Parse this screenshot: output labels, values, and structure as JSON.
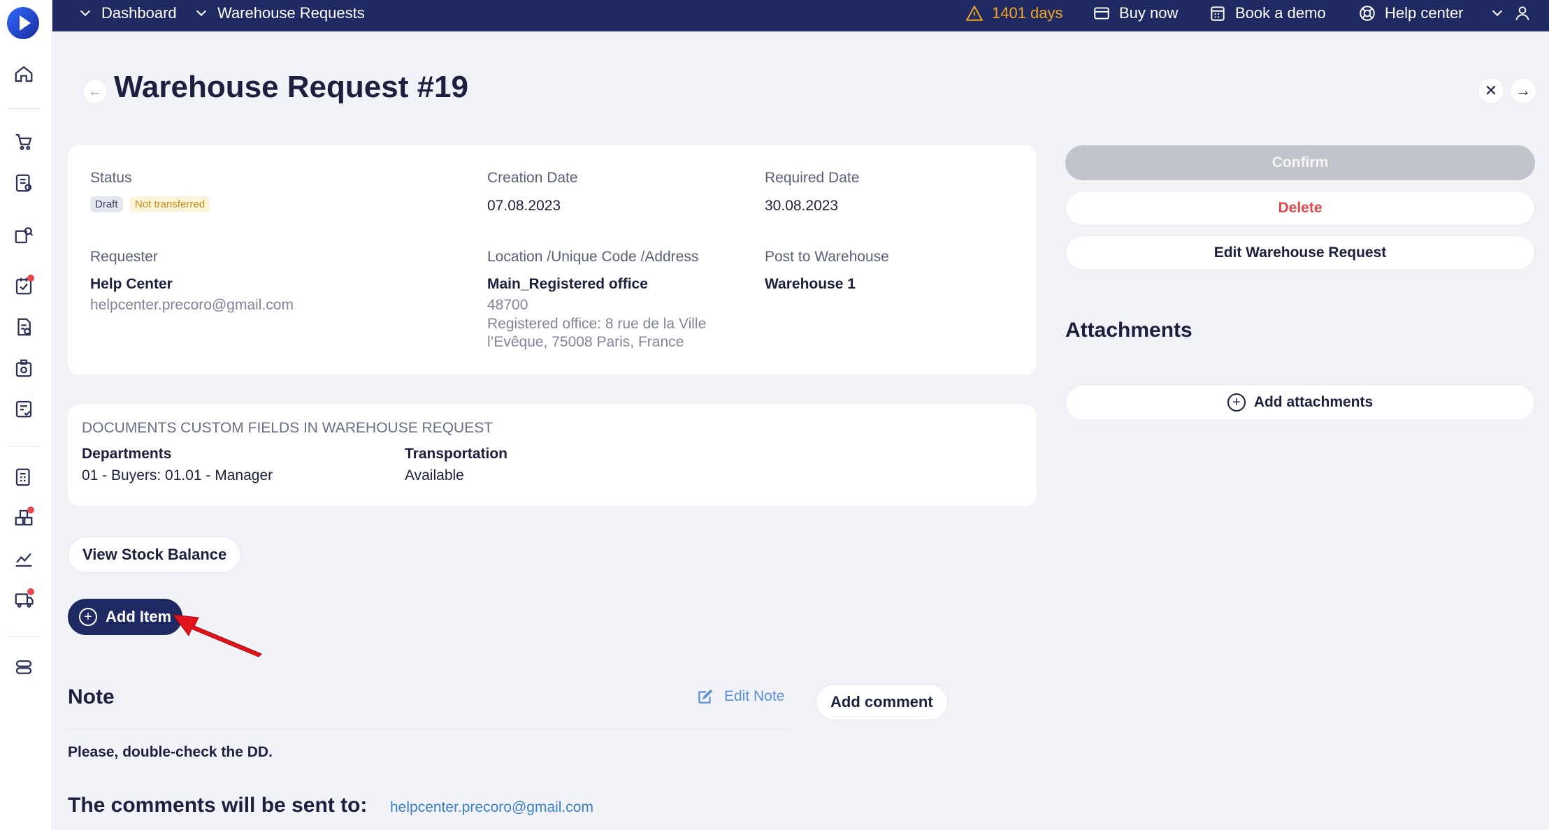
{
  "topbar": {
    "breadcrumb_1": "Dashboard",
    "breadcrumb_2": "Warehouse Requests",
    "trial": "1401 days",
    "buy_now": "Buy now",
    "book_demo": "Book a demo",
    "help_center": "Help center"
  },
  "header": {
    "title": "Warehouse Request #19",
    "back": "←",
    "close": "✕",
    "next": "→"
  },
  "details": {
    "status_label": "Status",
    "status_draft": "Draft",
    "status_transfer": "Not transferred",
    "creation_label": "Creation Date",
    "creation_value": "07.08.2023",
    "required_label": "Required Date",
    "required_value": "30.08.2023",
    "requester_label": "Requester",
    "requester_name": "Help Center",
    "requester_email": "helpcenter.precoro@gmail.com",
    "location_label": "Location /Unique Code /Address",
    "location_name": "Main_Registered office",
    "location_code": "48700",
    "location_address_1": "Registered office: 8 rue de la Ville",
    "location_address_2": "l’Evêque, 75008 Paris, France",
    "post_label": "Post to Warehouse",
    "post_value": "Warehouse 1"
  },
  "custom_fields": {
    "heading": "DOCUMENTS CUSTOM FIELDS IN WAREHOUSE REQUEST",
    "dept_label": "Departments",
    "dept_value": "01 - Buyers: 01.01 - Manager",
    "transport_label": "Transportation",
    "transport_value": "Available"
  },
  "actions": {
    "confirm": "Confirm",
    "delete": "Delete",
    "edit": "Edit Warehouse Request",
    "attachments_title": "Attachments",
    "add_attachments": "Add attachments",
    "view_stock": "View Stock Balance",
    "add_item": "Add Item"
  },
  "note": {
    "title": "Note",
    "edit_note": "Edit Note",
    "add_comment": "Add comment",
    "text": "Please, double-check the DD.",
    "comments_title": "The comments will be sent to:",
    "comments_email": "helpcenter.precoro@gmail.com"
  },
  "colors": {
    "topbar": "#1f2a63",
    "warning": "#f5a623",
    "danger": "#e5484d",
    "link": "#3b7fc4"
  }
}
